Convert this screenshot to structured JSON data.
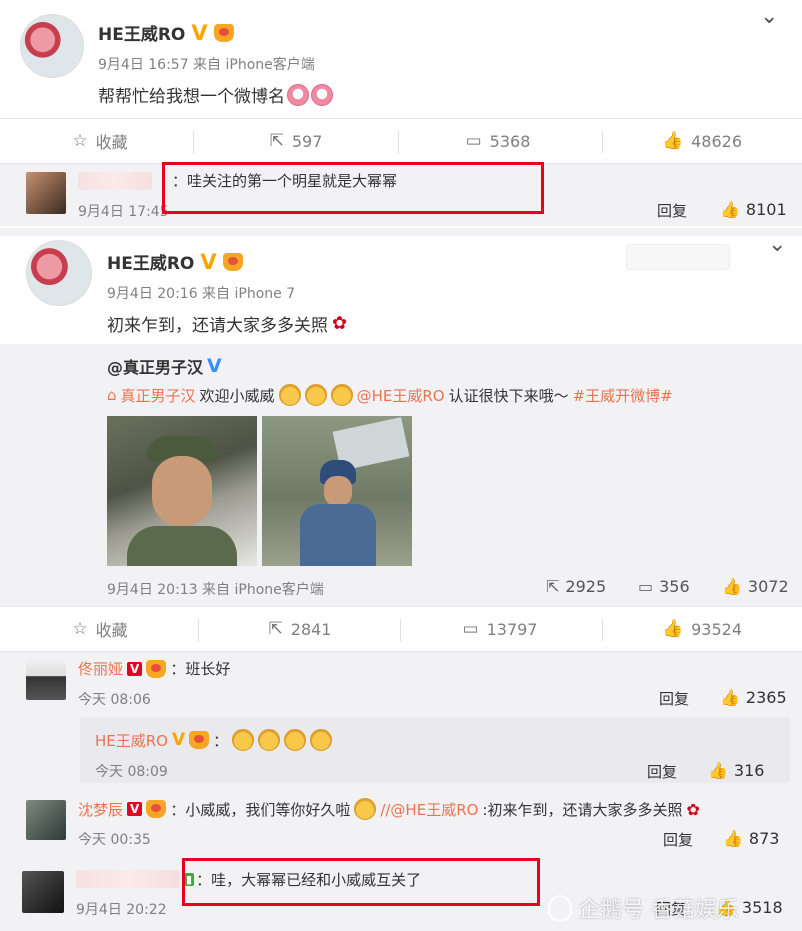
{
  "post1": {
    "author": "HE王威RO",
    "meta": "9月4日 16:57 来自 iPhone客户端",
    "text": "帮帮忙给我想一个微博名",
    "actions": {
      "favorite": "收藏",
      "repost": "597",
      "comment": "5368",
      "like": "48626"
    }
  },
  "comment1": {
    "text": "：哇关注的第一个明星就是大幂幂",
    "time": "9月4日 17:45",
    "reply": "回复",
    "likes": "8101"
  },
  "post2": {
    "author": "HE王威RO",
    "meta": "9月4日 20:16 来自 iPhone 7",
    "text": "初来乍到，还请大家多多关照",
    "repost": {
      "author": "@真正男子汉",
      "source_label": "真正男子汉",
      "text_before": "欢迎小威威",
      "mention": "@HE王威RO",
      "text_after": "认证很快下来哦～",
      "hashtag": "#王威开微博#",
      "meta": "9月4日 20:13 来自 iPhone客户端",
      "reposts": "2925",
      "comments": "356",
      "likes": "3072"
    },
    "actions": {
      "favorite": "收藏",
      "repost": "2841",
      "comment": "13797",
      "like": "93524"
    }
  },
  "comments": [
    {
      "name": "佟丽娅",
      "text": "：班长好",
      "time": "今天 08:06",
      "reply": "回复",
      "likes": "2365"
    },
    {
      "name": "HE王威RO",
      "text": "：",
      "time": "今天 08:09",
      "reply": "回复",
      "likes": "316"
    },
    {
      "name": "沈梦辰",
      "text_before": "：小威威，我们等你好久啦",
      "mention": "//@HE王威RO",
      "text_after": ":初来乍到，还请大家多多关照",
      "time": "今天 00:35",
      "reply": "回复",
      "likes": "873"
    },
    {
      "name": "",
      "text": "：哇，大幂幂已经和小威威互关了",
      "time": "9月4日 20:22",
      "reply": "回复",
      "likes": "3518"
    }
  ],
  "watermark": "企鹅号 香菇娱乐",
  "colors": {
    "accent": "#eb7350",
    "highlight_box": "#e6001f",
    "verified": "#f5a600",
    "link": "#eb7350"
  },
  "icons": [
    "chevron-down-icon",
    "star-icon",
    "repost-icon",
    "comment-icon",
    "thumb-up-icon",
    "verified-icon",
    "crown-icon",
    "rose-icon"
  ]
}
